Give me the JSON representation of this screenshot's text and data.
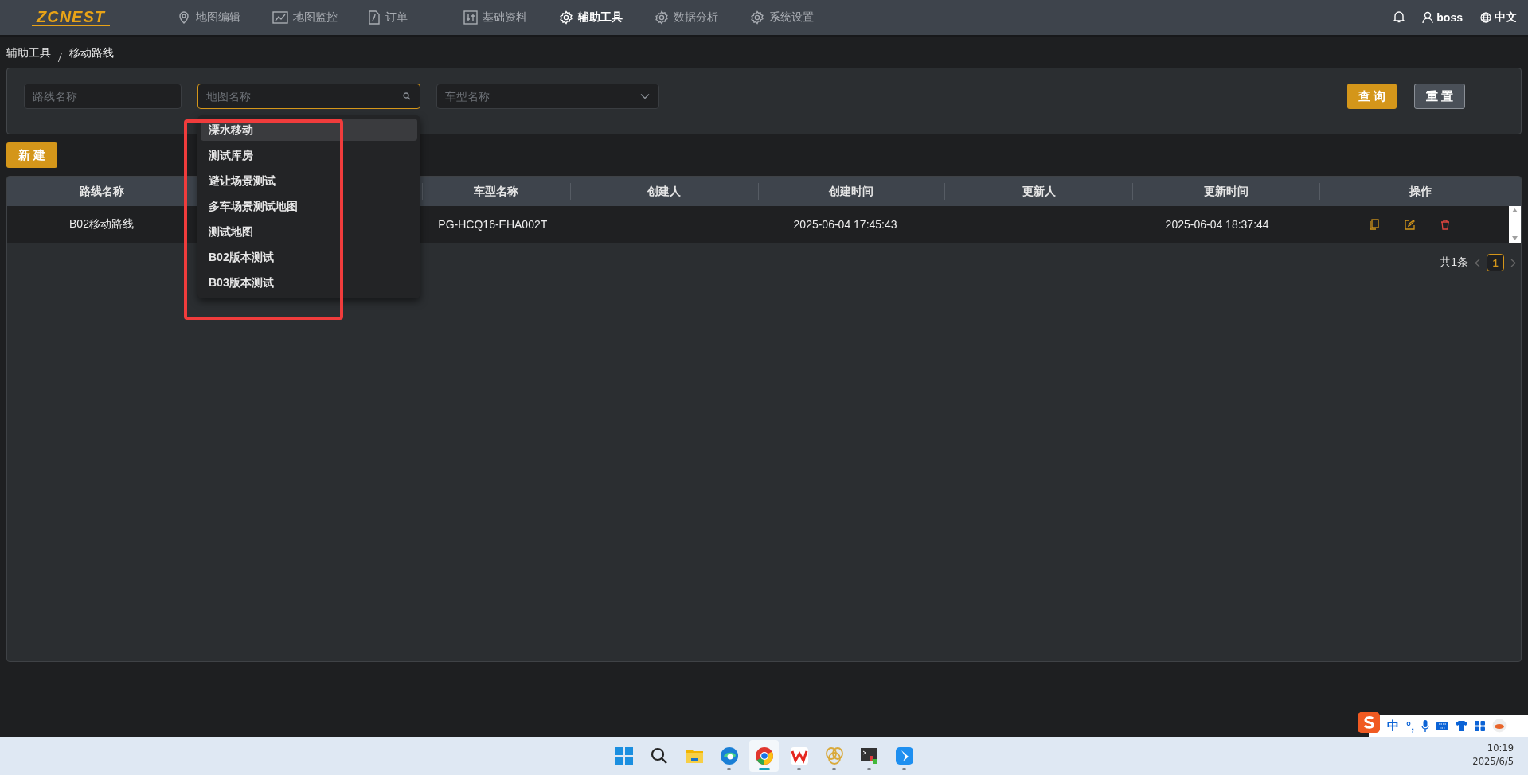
{
  "nav": {
    "logo": "ZCNEST",
    "items": [
      {
        "label": "地图编辑",
        "selected": false
      },
      {
        "label": "地图监控",
        "selected": false
      },
      {
        "label": "订单",
        "selected": false
      },
      {
        "label": "基础资料",
        "selected": false
      },
      {
        "label": "辅助工具",
        "selected": true
      },
      {
        "label": "数据分析",
        "selected": false
      },
      {
        "label": "系统设置",
        "selected": false
      }
    ],
    "user": "boss",
    "language": "中文"
  },
  "breadcrumb": [
    "辅助工具",
    "移动路线"
  ],
  "filters": [
    {
      "kind": "text",
      "placeholder": "路线名称",
      "focused": false
    },
    {
      "kind": "search",
      "placeholder": "地图名称",
      "focused": true
    },
    {
      "kind": "select",
      "placeholder": "车型名称",
      "focused": false
    }
  ],
  "buttons": [
    {
      "label": "查 询",
      "kind": "primary"
    },
    {
      "label": "重 置",
      "kind": "secondary"
    }
  ],
  "dropdown": {
    "items": [
      {
        "label": "溧水移动",
        "highlighted": true
      },
      {
        "label": "测试库房",
        "highlighted": false
      },
      {
        "label": "避让场景测试",
        "highlighted": false
      },
      {
        "label": "多车场景测试地图",
        "highlighted": false
      },
      {
        "label": "测试地图",
        "highlighted": false
      },
      {
        "label": "B02版本测试",
        "highlighted": false
      },
      {
        "label": "B03版本测试",
        "highlighted": false
      }
    ]
  },
  "annotation": {
    "kind": "rectangle",
    "color": "#f03c3c"
  },
  "new_button": "新 建",
  "table": {
    "columns": [
      {
        "label": "路线名称"
      },
      {},
      {
        "label": "车型名称"
      },
      {
        "label": "创建人"
      },
      {
        "label": "创建时间"
      },
      {
        "label": "更新人"
      },
      {
        "label": "更新时间"
      },
      {
        "label": "操作"
      }
    ],
    "rows": [
      {
        "cells": [
          "B02移动路线",
          null,
          "PG-HCQ16-EHA002T",
          null,
          "2025-06-04 17:45:43",
          null,
          "2025-06-04 18:37:44"
        ]
      }
    ]
  },
  "pagination": {
    "total": "共1条",
    "pages": [
      {
        "label": "1",
        "selected": true
      }
    ]
  },
  "ime": {
    "mode": "中",
    "punctuation": "°,"
  },
  "taskbar": {
    "apps": [
      {
        "kind": "start",
        "active": false,
        "running": false
      },
      {
        "kind": "search",
        "active": false,
        "running": false
      },
      {
        "kind": "folder",
        "active": false,
        "running": false
      },
      {
        "kind": "edge",
        "active": false,
        "running": true
      },
      {
        "kind": "chrome",
        "active": true,
        "running": true
      },
      {
        "kind": "wps",
        "active": false,
        "running": true
      },
      {
        "kind": "rings",
        "active": false,
        "running": true
      },
      {
        "kind": "terminal",
        "active": false,
        "running": true
      },
      {
        "kind": "bird",
        "active": false,
        "running": true
      }
    ],
    "time": "10:19",
    "date": "2025/6/5"
  }
}
